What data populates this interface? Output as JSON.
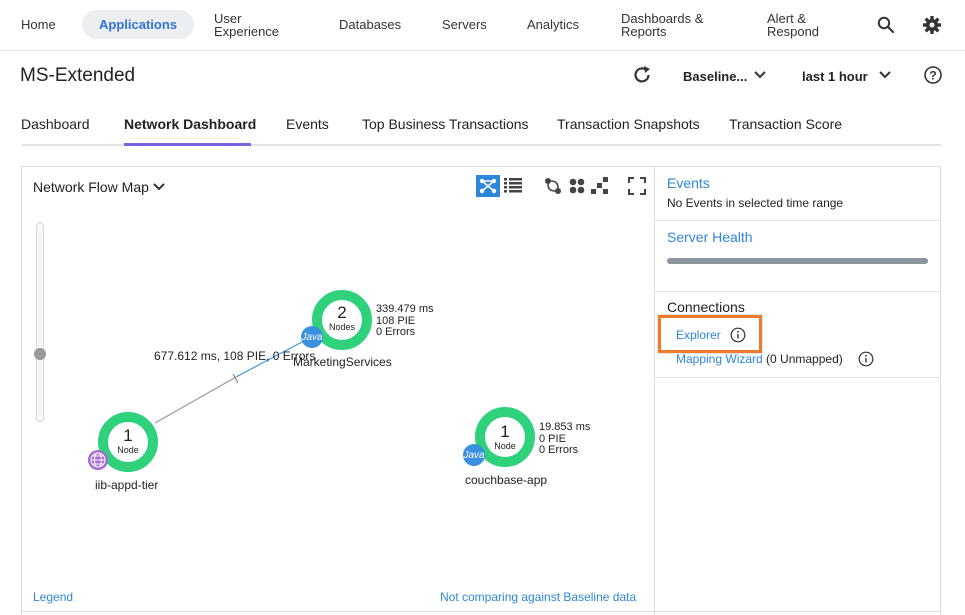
{
  "nav": {
    "home": "Home",
    "applications": "Applications",
    "user_experience_1": "User",
    "user_experience_2": "Experience",
    "databases": "Databases",
    "servers": "Servers",
    "analytics": "Analytics",
    "dashboards_1": "Dashboards &",
    "dashboards_2": "Reports",
    "alert_1": "Alert &",
    "alert_2": "Respond"
  },
  "titlebar": {
    "title": "MS-Extended",
    "baseline": "Baseline...",
    "time_range": "last 1 hour"
  },
  "tabs": {
    "dashboard": "Dashboard",
    "network_dashboard": "Network Dashboard",
    "events": "Events",
    "top_business_transactions": "Top Business Transactions",
    "transaction_snapshots": "Transaction Snapshots",
    "transaction_score": "Transaction Score"
  },
  "flowmap": {
    "title": "Network Flow Map",
    "legend": "Legend",
    "not_comparing": "Not comparing against Baseline data",
    "connection_label": "677.612 ms, 108 PIE, 0 Errors",
    "nodes": [
      {
        "name": "MarketingServices",
        "count": "2",
        "unit": "Nodes",
        "badge": "Java",
        "stat1": "339.479 ms",
        "stat2": "108 PIE",
        "stat3": "0 Errors"
      },
      {
        "name": "iib-appd-tier",
        "count": "1",
        "unit": "Node",
        "badge": "",
        "stat1": "",
        "stat2": "",
        "stat3": ""
      },
      {
        "name": "couchbase-app",
        "count": "1",
        "unit": "Node",
        "badge": "Java",
        "stat1": "19.853 ms",
        "stat2": "0 PIE",
        "stat3": "0 Errors"
      }
    ]
  },
  "right": {
    "events_title": "Events",
    "events_text": "No Events in selected time range",
    "server_health": "Server Health",
    "server_health_fill": 1.0,
    "connections": "Connections",
    "explorer": "Explorer",
    "mapping_wizard": "Mapping Wizard",
    "unmapped": "(0 Unmapped)"
  },
  "colors": {
    "accent": "#2f73d9",
    "link": "#2f86d9",
    "node_ring": "#2fd17d",
    "highlight_box": "#f07b2d",
    "tab_underline": "#7a62e0"
  },
  "icons": [
    "search-icon",
    "gear-icon",
    "refresh-icon",
    "chevron-down-icon",
    "help-icon",
    "flowmap-view-icon",
    "list-view-icon",
    "expand-icon",
    "info-icon",
    "globe-icon"
  ]
}
